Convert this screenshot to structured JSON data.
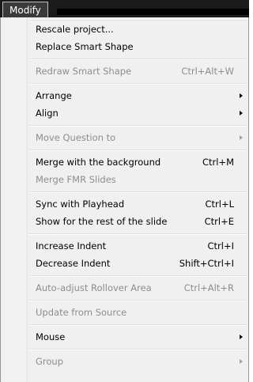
{
  "menubar": {
    "title": "Modify"
  },
  "menu": {
    "items": [
      {
        "label": "Rescale project...",
        "shortcut": "",
        "submenu": false,
        "enabled": true
      },
      {
        "label": "Replace Smart Shape",
        "shortcut": "",
        "submenu": false,
        "enabled": true
      },
      {
        "label": "Redraw Smart Shape",
        "shortcut": "Ctrl+Alt+W",
        "submenu": false,
        "enabled": false
      },
      {
        "label": "Arrange",
        "shortcut": "",
        "submenu": true,
        "enabled": true
      },
      {
        "label": "Align",
        "shortcut": "",
        "submenu": true,
        "enabled": true
      },
      {
        "label": "Move Question to",
        "shortcut": "",
        "submenu": true,
        "enabled": false
      },
      {
        "label": "Merge with the background",
        "shortcut": "Ctrl+M",
        "submenu": false,
        "enabled": true
      },
      {
        "label": "Merge FMR Slides",
        "shortcut": "",
        "submenu": false,
        "enabled": false
      },
      {
        "label": "Sync with Playhead",
        "shortcut": "Ctrl+L",
        "submenu": false,
        "enabled": true
      },
      {
        "label": "Show for the rest of the slide",
        "shortcut": "Ctrl+E",
        "submenu": false,
        "enabled": true
      },
      {
        "label": "Increase Indent",
        "shortcut": "Ctrl+I",
        "submenu": false,
        "enabled": true
      },
      {
        "label": "Decrease Indent",
        "shortcut": "Shift+Ctrl+I",
        "submenu": false,
        "enabled": true
      },
      {
        "label": "Auto-adjust Rollover Area",
        "shortcut": "Ctrl+Alt+R",
        "submenu": false,
        "enabled": false
      },
      {
        "label": "Update from Source",
        "shortcut": "",
        "submenu": false,
        "enabled": false
      },
      {
        "label": "Mouse",
        "shortcut": "",
        "submenu": true,
        "enabled": true
      },
      {
        "label": "Group",
        "shortcut": "",
        "submenu": true,
        "enabled": false
      }
    ]
  },
  "colors": {
    "menubar_bg": "#1a1a1a",
    "menu_bg": "#f0f0f0",
    "text_enabled": "#000000",
    "text_disabled": "#8d8d8d"
  }
}
